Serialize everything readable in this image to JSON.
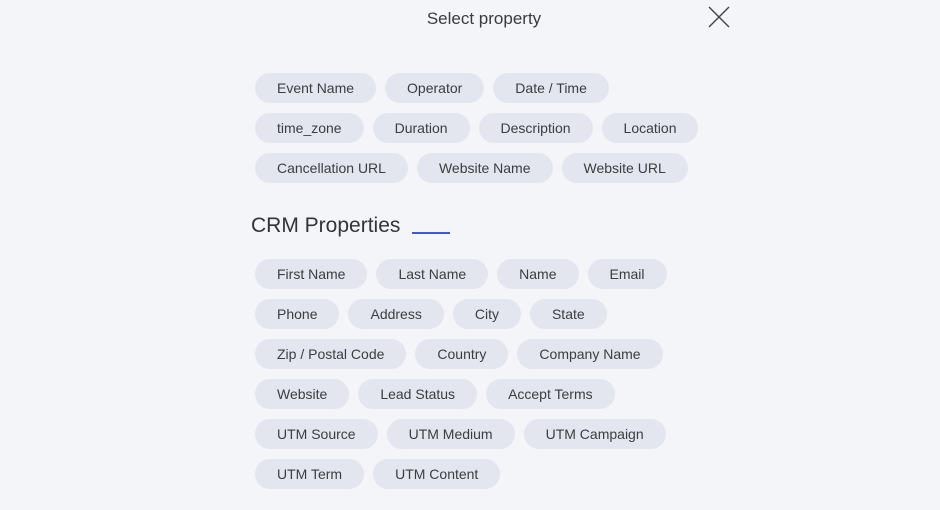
{
  "header": {
    "title": "Select property",
    "close_icon": "close-icon"
  },
  "event_properties": {
    "rows": [
      [
        "Event Name",
        "Operator",
        "Date / Time"
      ],
      [
        "time_zone",
        "Duration",
        "Description",
        "Location"
      ],
      [
        "Cancellation URL",
        "Website Name",
        "Website URL"
      ]
    ]
  },
  "crm_section": {
    "title": "CRM Properties",
    "accent_color": "#3a5bd9",
    "rows": [
      [
        "First Name",
        "Last Name",
        "Name",
        "Email"
      ],
      [
        "Phone",
        "Address",
        "City",
        "State"
      ],
      [
        "Zip / Postal Code",
        "Country",
        "Company Name"
      ],
      [
        "Website",
        "Lead Status",
        "Accept Terms"
      ],
      [
        "UTM Source",
        "UTM Medium",
        "UTM Campaign"
      ],
      [
        "UTM Term",
        "UTM Content"
      ]
    ]
  }
}
